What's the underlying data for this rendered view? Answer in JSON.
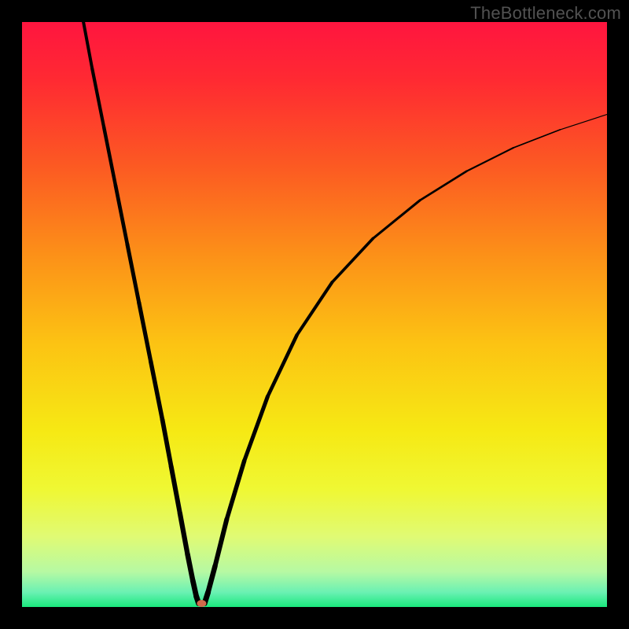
{
  "watermark": "TheBottleneck.com",
  "chart_data": {
    "type": "line",
    "title": "",
    "xlabel": "",
    "ylabel": "",
    "xlim": [
      0,
      100
    ],
    "ylim": [
      0,
      100
    ],
    "grid": false,
    "legend": false,
    "background_gradient_stops": [
      {
        "offset": 0.0,
        "color": "#ff153f"
      },
      {
        "offset": 0.1,
        "color": "#ff2a32"
      },
      {
        "offset": 0.25,
        "color": "#fc5b22"
      },
      {
        "offset": 0.4,
        "color": "#fc9118"
      },
      {
        "offset": 0.55,
        "color": "#fcc313"
      },
      {
        "offset": 0.7,
        "color": "#f6e914"
      },
      {
        "offset": 0.8,
        "color": "#eff834"
      },
      {
        "offset": 0.88,
        "color": "#e0fa74"
      },
      {
        "offset": 0.94,
        "color": "#b6f9a3"
      },
      {
        "offset": 0.975,
        "color": "#6af1b3"
      },
      {
        "offset": 1.0,
        "color": "#1ae87d"
      }
    ],
    "series": [
      {
        "name": "left-branch",
        "color": "#000000",
        "width_start": 4,
        "width_end": 7,
        "x": [
          10.5,
          12,
          14,
          16,
          18,
          20,
          22,
          24,
          25.5,
          27,
          28.3,
          29.2,
          29.8,
          30.2
        ],
        "y": [
          100,
          92,
          82,
          72,
          62,
          52,
          42,
          32,
          24,
          16,
          9,
          4.5,
          1.8,
          0.6
        ]
      },
      {
        "name": "right-branch",
        "color": "#000000",
        "width_start": 7,
        "width_end": 1.2,
        "x": [
          31.2,
          31.8,
          33,
          35,
          38,
          42,
          47,
          53,
          60,
          68,
          76,
          84,
          92,
          100
        ],
        "y": [
          0.6,
          2.5,
          7,
          15,
          25,
          36,
          46.5,
          55.5,
          63,
          69.5,
          74.5,
          78.5,
          81.6,
          84.2
        ]
      }
    ],
    "minimum_marker": {
      "x": 30.7,
      "y": 0.0,
      "width": 12,
      "height": 9,
      "color": "#d06a4b"
    }
  }
}
